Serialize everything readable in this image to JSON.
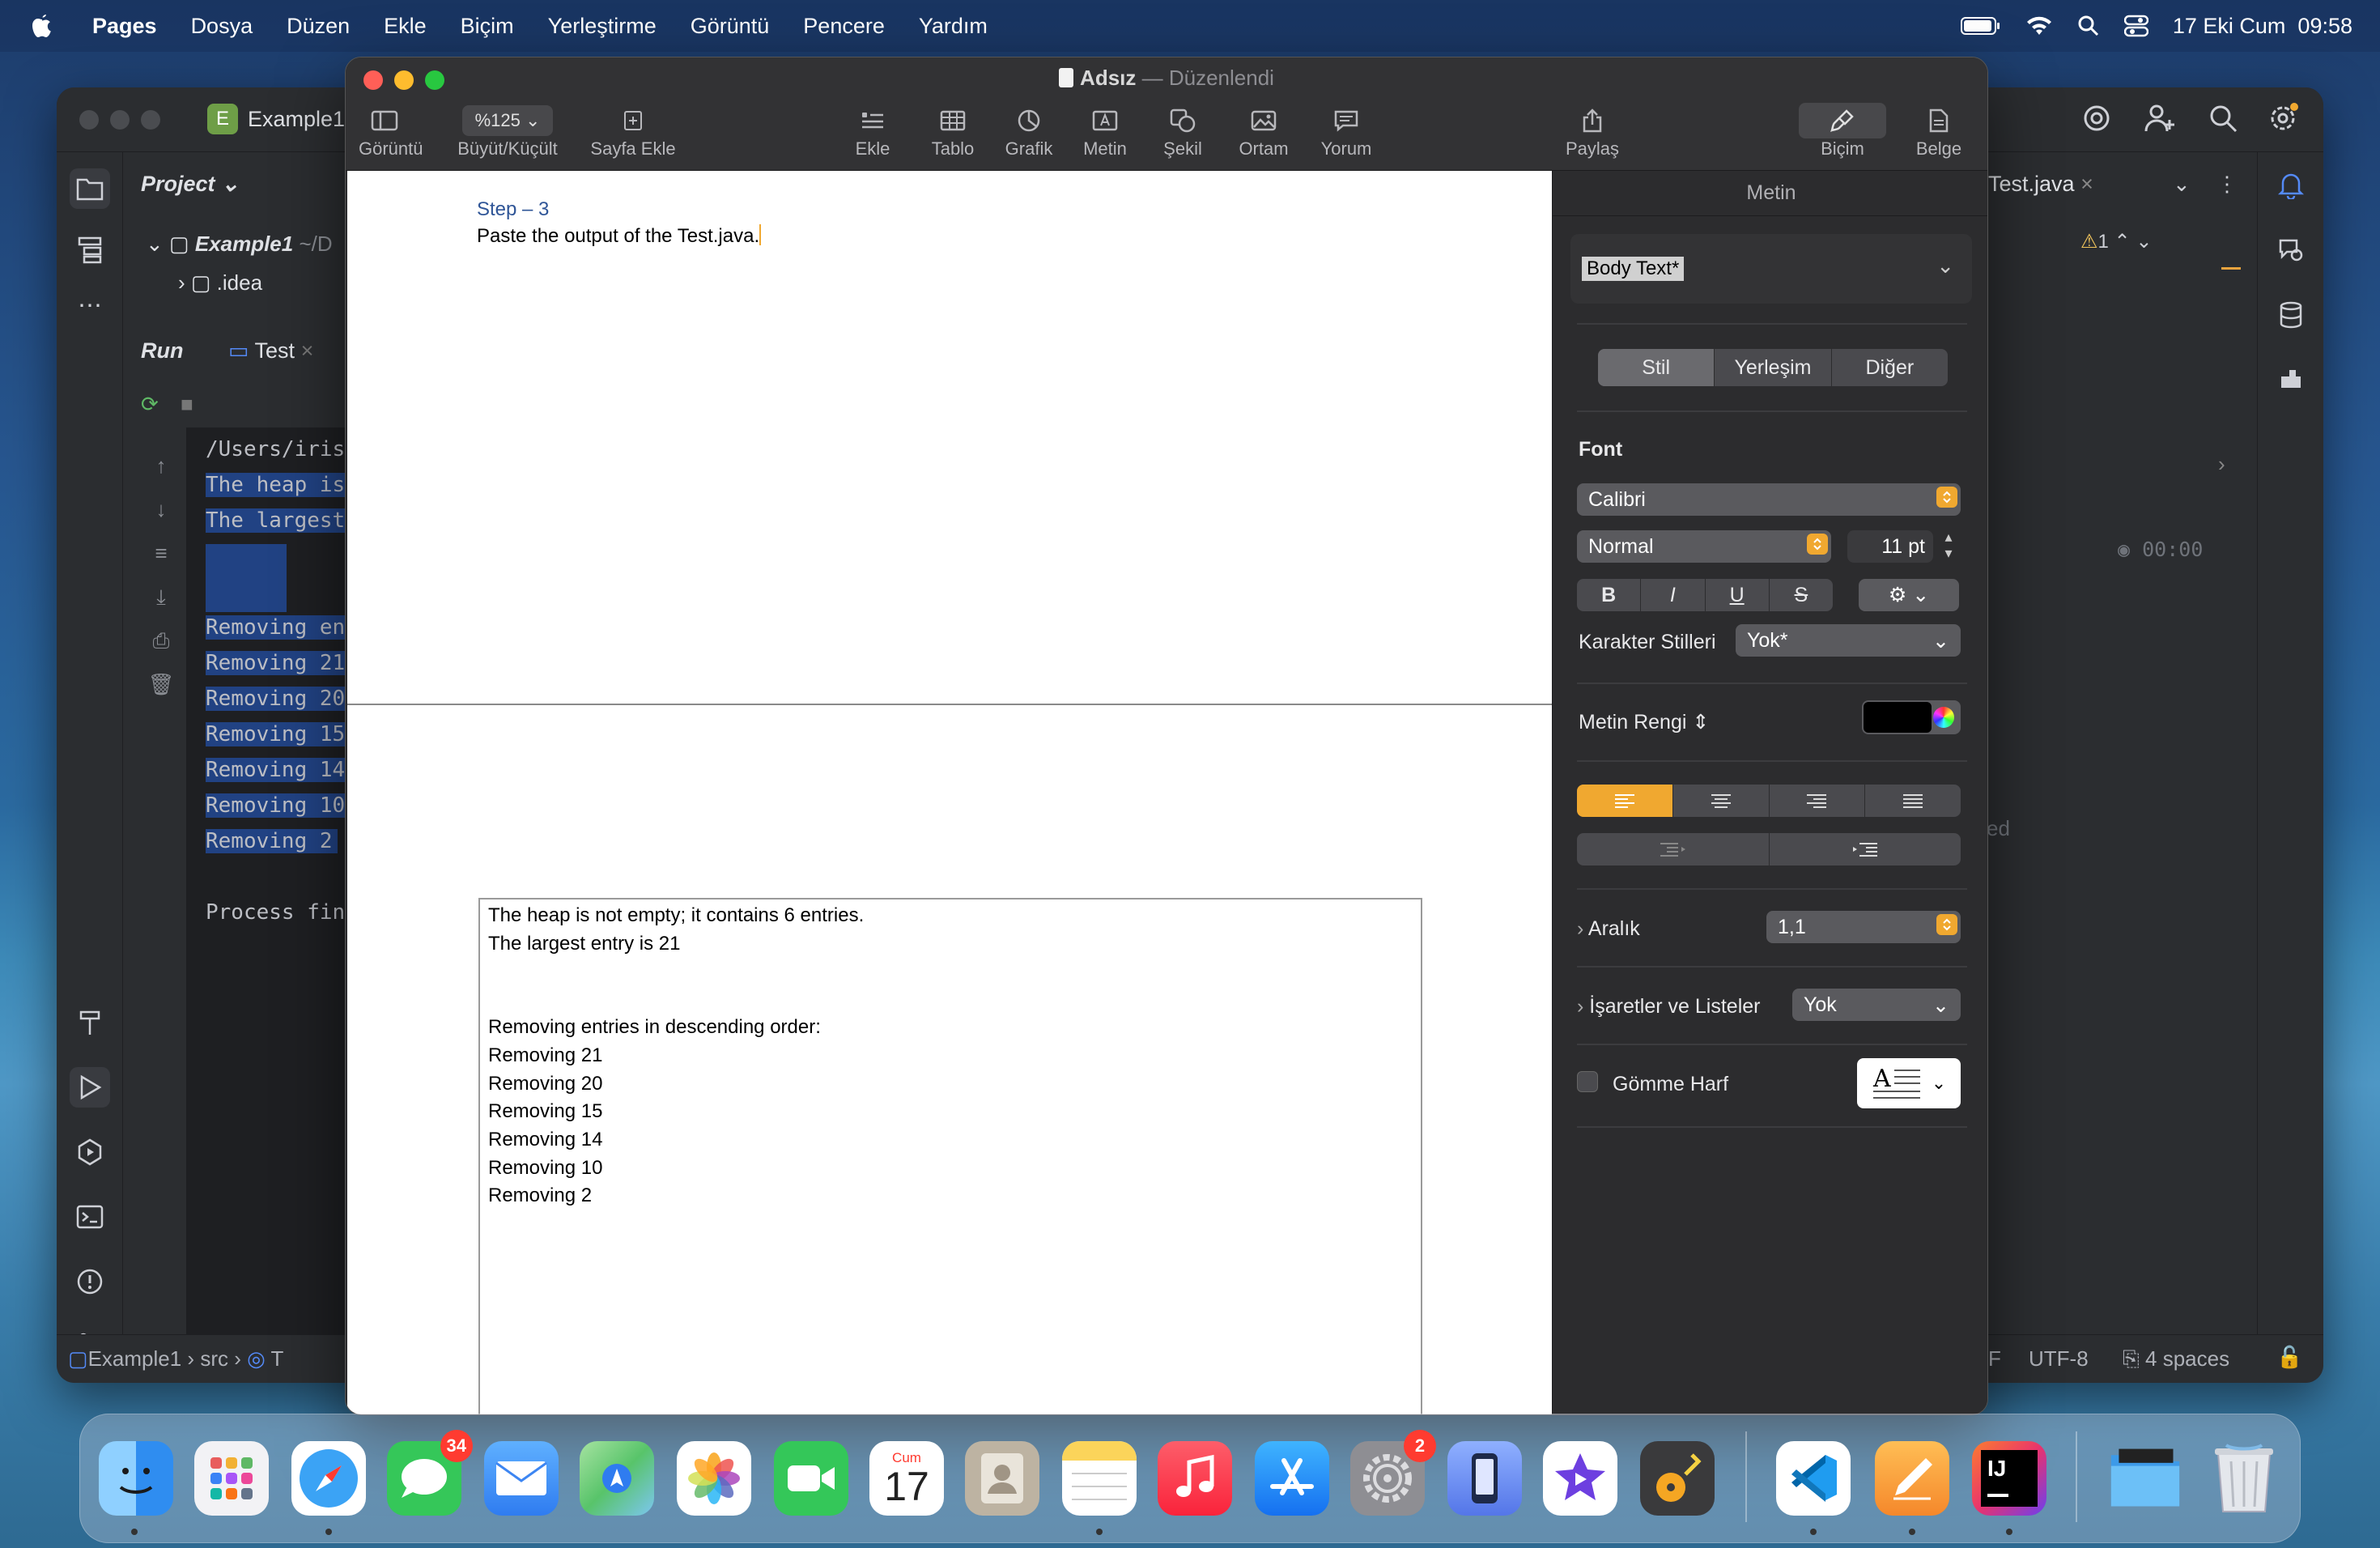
{
  "menubar": {
    "app_name": "Pages",
    "items": [
      "Dosya",
      "Düzen",
      "Ekle",
      "Biçim",
      "Yerleştirme",
      "Görüntü",
      "Pencere",
      "Yardım"
    ],
    "clock": "17 Eki Cum  09:58"
  },
  "ide": {
    "project_name": "Example1",
    "project_label": "Project",
    "tree_root": "Example1",
    "tree_root_path": "~/D",
    "tree_idea": ".idea",
    "run_label": "Run",
    "run_tab": "Test",
    "editor_tab": "Test.java",
    "warning_count": "1",
    "timer": "00:00",
    "partial_text": "ed",
    "console_lines": [
      "/Users/iris",
      "The heap is",
      "The largest",
      "Removing en",
      "Removing 21",
      "Removing 20",
      "Removing 15",
      "Removing 14",
      "Removing 10",
      "Removing 2",
      "Process fin"
    ],
    "status": {
      "crumb1": "Example1",
      "crumb2": "src",
      "crumb3": "T",
      "partial": "F",
      "encoding": "UTF-8",
      "indent": "4 spaces"
    }
  },
  "pages": {
    "doc_title": "Adsız",
    "doc_state": "Düzenlendi",
    "toolbar_left": [
      {
        "label": "Görüntü",
        "icon": "sidebar-icon"
      },
      {
        "label": "Büyüt/Küçült",
        "value": "%125",
        "icon": "zoom-select"
      },
      {
        "label": "Sayfa Ekle",
        "icon": "add-page-icon"
      }
    ],
    "toolbar_center": [
      {
        "label": "Ekle",
        "icon": "list-icon"
      },
      {
        "label": "Tablo",
        "icon": "table-icon"
      },
      {
        "label": "Grafik",
        "icon": "chart-icon"
      },
      {
        "label": "Metin",
        "icon": "textbox-icon"
      },
      {
        "label": "Şekil",
        "icon": "shape-icon"
      },
      {
        "label": "Ortam",
        "icon": "media-icon"
      },
      {
        "label": "Yorum",
        "icon": "comment-icon"
      }
    ],
    "toolbar_share": "Paylaş",
    "toolbar_right": [
      {
        "label": "Biçim",
        "icon": "format-brush-icon"
      },
      {
        "label": "Belge",
        "icon": "document-icon"
      }
    ],
    "document": {
      "step_heading": "Step – 3",
      "step_text": "Paste the output of the Test.java.",
      "output_lines": [
        "The heap is not empty; it contains 6 entries.",
        "The largest entry is 21",
        "",
        "Removing entries in descending order:",
        "Removing 21",
        "Removing 20",
        "Removing 15",
        "Removing 14",
        "Removing 10",
        "Removing 2"
      ]
    },
    "inspector": {
      "header": "Metin",
      "paragraph_style": "Body Text*",
      "tabs": [
        "Stil",
        "Yerleşim",
        "Diğer"
      ],
      "font_label": "Font",
      "font_family": "Calibri",
      "font_style": "Normal",
      "font_size": "11 pt",
      "format_buttons": [
        "B",
        "I",
        "U",
        "S"
      ],
      "char_styles_label": "Karakter Stilleri",
      "char_styles_value": "Yok*",
      "text_color_label": "Metin Rengi",
      "text_color": "#000000",
      "spacing_label": "Aralık",
      "spacing_value": "1,1",
      "bullets_label": "İşaretler ve Listeler",
      "bullets_value": "Yok",
      "dropcap_label": "Gömme Harf"
    }
  },
  "dock": {
    "apps": [
      {
        "name": "Finder",
        "color": "#2f8df0"
      },
      {
        "name": "Launchpad",
        "color": "#f2f2f5"
      },
      {
        "name": "Safari",
        "color": "#3ba3f5"
      },
      {
        "name": "Mesajlar",
        "color": "#35c759",
        "badge": "34"
      },
      {
        "name": "Mail",
        "color": "#3d86f2"
      },
      {
        "name": "Haritalar",
        "color": "#58c46a"
      },
      {
        "name": "Fotoğraflar",
        "color": "#ffffff"
      },
      {
        "name": "FaceTime",
        "color": "#34c759"
      },
      {
        "name": "Takvim",
        "color": "#ffffff",
        "day_label": "Cum",
        "day": "17"
      },
      {
        "name": "Kişiler",
        "color": "#bdb3a2"
      },
      {
        "name": "Notlar",
        "color": "#fbe38a"
      },
      {
        "name": "Müzik",
        "color": "#fc3c44"
      },
      {
        "name": "App Store",
        "color": "#1e8ef5"
      },
      {
        "name": "Sistem Ayarları",
        "color": "#8e8e93",
        "badge": "2"
      },
      {
        "name": "Simulator",
        "color": "#6f8ff0"
      },
      {
        "name": "iMovie",
        "color": "#7a5cf0"
      },
      {
        "name": "GarageBand",
        "color": "#555555"
      },
      {
        "name": "Visual Studio Code",
        "color": "#ffffff"
      },
      {
        "name": "Pages",
        "color": "#f59a2b"
      },
      {
        "name": "IntelliJ IDEA",
        "color": "#e8336d",
        "text": "IJ"
      },
      {
        "name": "Folder",
        "color": "#5bb0f2"
      },
      {
        "name": "Trash",
        "color": "#d8dce2"
      }
    ]
  }
}
